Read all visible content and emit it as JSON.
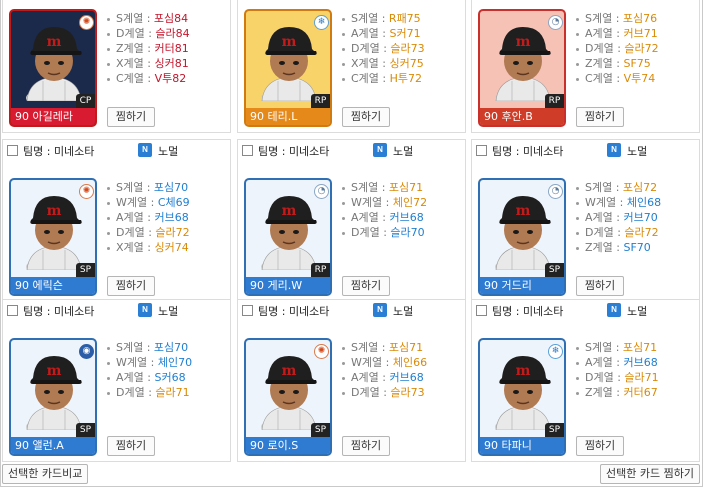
{
  "colors": {
    "red": "#c4152b",
    "blue": "#1f7fd1",
    "orange": "#d98a07",
    "accent_blue": "#2f7bd1"
  },
  "cards": [
    {
      "show_head": false,
      "team_label": "",
      "grade": "",
      "name": "90 아길레라",
      "position": "CP",
      "badge_icon": "fire-icon",
      "badge_glyph": "✺",
      "theme": "bg-red",
      "stats": [
        {
          "label": "S계열 : ",
          "value": "포심84",
          "color": "#c4152b"
        },
        {
          "label": "D계열 : ",
          "value": "슬라84",
          "color": "#c4152b"
        },
        {
          "label": "Z계열 : ",
          "value": "커터81",
          "color": "#c4152b"
        },
        {
          "label": "X계열 : ",
          "value": "싱커81",
          "color": "#c4152b"
        },
        {
          "label": "C계열 : ",
          "value": "V투82",
          "color": "#c4152b"
        }
      ],
      "zzim": "찜하기"
    },
    {
      "show_head": false,
      "team_label": "",
      "grade": "",
      "name": "90 테리.L",
      "position": "RP",
      "badge_icon": "snowflake-icon",
      "badge_glyph": "❄",
      "theme": "bg-orange",
      "stats": [
        {
          "label": "S계열 : ",
          "value": "R패75",
          "color": "#d98a07"
        },
        {
          "label": "A계열 : ",
          "value": "S커71",
          "color": "#d98a07"
        },
        {
          "label": "D계열 : ",
          "value": "슬라73",
          "color": "#d98a07"
        },
        {
          "label": "X계열 : ",
          "value": "싱커75",
          "color": "#d98a07"
        },
        {
          "label": "C계열 : ",
          "value": "H투72",
          "color": "#d98a07"
        }
      ],
      "zzim": "찜하기"
    },
    {
      "show_head": false,
      "team_label": "",
      "grade": "",
      "name": "90 후안.B",
      "position": "RP",
      "badge_icon": "ball-icon",
      "badge_glyph": "◔",
      "theme": "bg-pink",
      "stats": [
        {
          "label": "S계열 : ",
          "value": "포심76",
          "color": "#d98a07"
        },
        {
          "label": "A계열 : ",
          "value": "커브71",
          "color": "#d98a07"
        },
        {
          "label": "D계열 : ",
          "value": "슬라72",
          "color": "#d98a07"
        },
        {
          "label": "Z계열 : ",
          "value": "SF75",
          "color": "#d98a07"
        },
        {
          "label": "C계열 : ",
          "value": "V투74",
          "color": "#d98a07"
        }
      ],
      "zzim": "찜하기"
    },
    {
      "show_head": true,
      "team_label": "팀명 : 미네소타",
      "grade": "노멀",
      "name": "90 에릭슨",
      "position": "SP",
      "badge_icon": "fire-icon",
      "badge_glyph": "✺",
      "theme": "",
      "stats": [
        {
          "label": "S계열 : ",
          "value": "포심70",
          "color": "#1f7fd1"
        },
        {
          "label": "W계열 : ",
          "value": "C체69",
          "color": "#1f7fd1"
        },
        {
          "label": "A계열 : ",
          "value": "커브68",
          "color": "#1f7fd1"
        },
        {
          "label": "D계열 : ",
          "value": "슬라72",
          "color": "#d98a07"
        },
        {
          "label": "X계열 : ",
          "value": "싱커74",
          "color": "#d98a07"
        }
      ],
      "zzim": "찜하기"
    },
    {
      "show_head": true,
      "team_label": "팀명 : 미네소타",
      "grade": "노멀",
      "name": "90 게리.W",
      "position": "RP",
      "badge_icon": "ball-icon",
      "badge_glyph": "◔",
      "theme": "",
      "stats": [
        {
          "label": "S계열 : ",
          "value": "포심71",
          "color": "#d98a07"
        },
        {
          "label": "W계열 : ",
          "value": "체인72",
          "color": "#d98a07"
        },
        {
          "label": "A계열 : ",
          "value": "커브68",
          "color": "#1f7fd1"
        },
        {
          "label": "D계열 : ",
          "value": "슬라70",
          "color": "#1f7fd1"
        }
      ],
      "zzim": "찜하기"
    },
    {
      "show_head": true,
      "team_label": "팀명 : 미네소타",
      "grade": "노멀",
      "name": "90 거드리",
      "position": "SP",
      "badge_icon": "ball-icon",
      "badge_glyph": "◔",
      "theme": "",
      "stats": [
        {
          "label": "S계열 : ",
          "value": "포심72",
          "color": "#d98a07"
        },
        {
          "label": "W계열 : ",
          "value": "체인68",
          "color": "#1f7fd1"
        },
        {
          "label": "A계열 : ",
          "value": "커브70",
          "color": "#1f7fd1"
        },
        {
          "label": "D계열 : ",
          "value": "슬라72",
          "color": "#d98a07"
        },
        {
          "label": "Z계열 : ",
          "value": "SF70",
          "color": "#1f7fd1"
        }
      ],
      "zzim": "찜하기"
    },
    {
      "show_head": true,
      "team_label": "팀명 : 미네소타",
      "grade": "노멀",
      "name": "90 앨런.A",
      "position": "SP",
      "badge_icon": "globe-icon",
      "badge_glyph": "◉",
      "theme": "",
      "stats": [
        {
          "label": "S계열 : ",
          "value": "포심70",
          "color": "#1f7fd1"
        },
        {
          "label": "W계열 : ",
          "value": "체인70",
          "color": "#1f7fd1"
        },
        {
          "label": "A계열 : ",
          "value": "S커68",
          "color": "#1f7fd1"
        },
        {
          "label": "D계열 : ",
          "value": "슬라71",
          "color": "#d98a07"
        }
      ],
      "zzim": "찜하기"
    },
    {
      "show_head": true,
      "team_label": "팀명 : 미네소타",
      "grade": "노멀",
      "name": "90 로이.S",
      "position": "SP",
      "badge_icon": "fire-icon",
      "badge_glyph": "✺",
      "theme": "",
      "stats": [
        {
          "label": "S계열 : ",
          "value": "포심71",
          "color": "#d98a07"
        },
        {
          "label": "W계열 : ",
          "value": "체인66",
          "color": "#d98a07"
        },
        {
          "label": "A계열 : ",
          "value": "커브68",
          "color": "#1f7fd1"
        },
        {
          "label": "D계열 : ",
          "value": "슬라73",
          "color": "#d98a07"
        }
      ],
      "zzim": "찜하기"
    },
    {
      "show_head": true,
      "team_label": "팀명 : 미네소타",
      "grade": "노멀",
      "name": "90 타파니",
      "position": "SP",
      "badge_icon": "snowflake-icon",
      "badge_glyph": "❄",
      "theme": "",
      "stats": [
        {
          "label": "S계열 : ",
          "value": "포심71",
          "color": "#d98a07"
        },
        {
          "label": "A계열 : ",
          "value": "커브68",
          "color": "#1f7fd1"
        },
        {
          "label": "D계열 : ",
          "value": "슬라71",
          "color": "#d98a07"
        },
        {
          "label": "Z계열 : ",
          "value": "커터67",
          "color": "#d98a07"
        }
      ],
      "zzim": "찜하기"
    }
  ],
  "footer": {
    "compare_button": "선택한 카드비교",
    "zzim_selected_button": "선택한 카드 찜하기"
  }
}
